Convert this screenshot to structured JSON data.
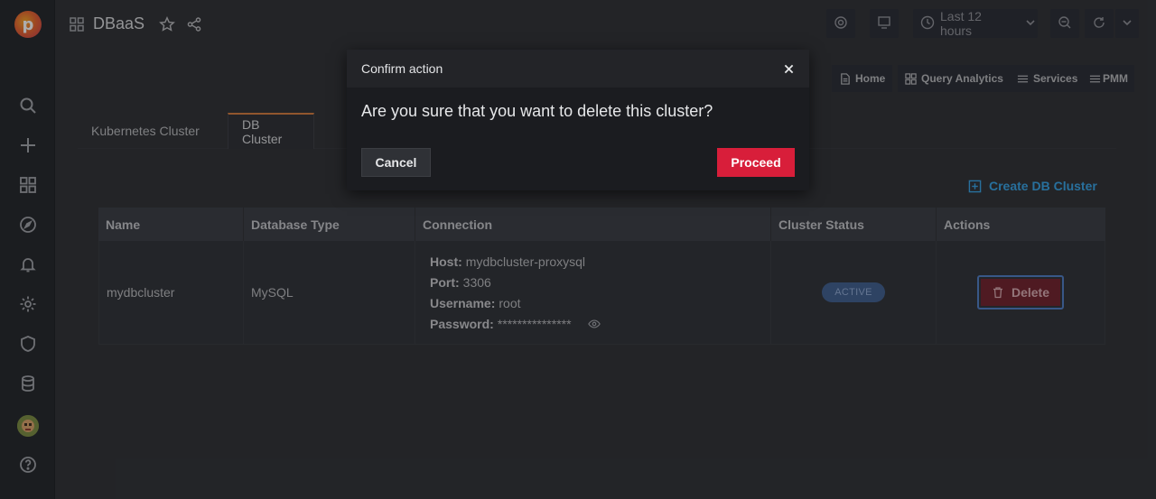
{
  "header": {
    "title": "DBaaS",
    "time_range": "Last 12 hours"
  },
  "links": [
    {
      "label": "Home",
      "icon": "doc-icon"
    },
    {
      "label": "Query Analytics",
      "icon": "apps-icon"
    },
    {
      "label": "Services",
      "icon": "bars-icon"
    },
    {
      "label": "PMM",
      "icon": "bars-icon"
    }
  ],
  "tabs": [
    {
      "label": "Kubernetes Cluster",
      "active": false
    },
    {
      "label": "DB Cluster",
      "active": true
    }
  ],
  "create_label": "Create DB Cluster",
  "table": {
    "headers": [
      "Name",
      "Database Type",
      "Connection",
      "Cluster Status",
      "Actions"
    ],
    "row": {
      "name": "mydbcluster",
      "db_type": "MySQL",
      "host_label": "Host:",
      "host": "mydbcluster-proxysql",
      "port_label": "Port:",
      "port": "3306",
      "user_label": "Username:",
      "user": "root",
      "pass_label": "Password:",
      "pass": "***************",
      "status": "ACTIVE",
      "delete_label": "Delete"
    }
  },
  "modal": {
    "title": "Confirm action",
    "message": "Are you sure that you want to delete this cluster?",
    "cancel": "Cancel",
    "proceed": "Proceed"
  },
  "colors": {
    "accent": "#33a2e5",
    "proceed": "#d81e3a",
    "tab_active": "#d47a3a"
  }
}
